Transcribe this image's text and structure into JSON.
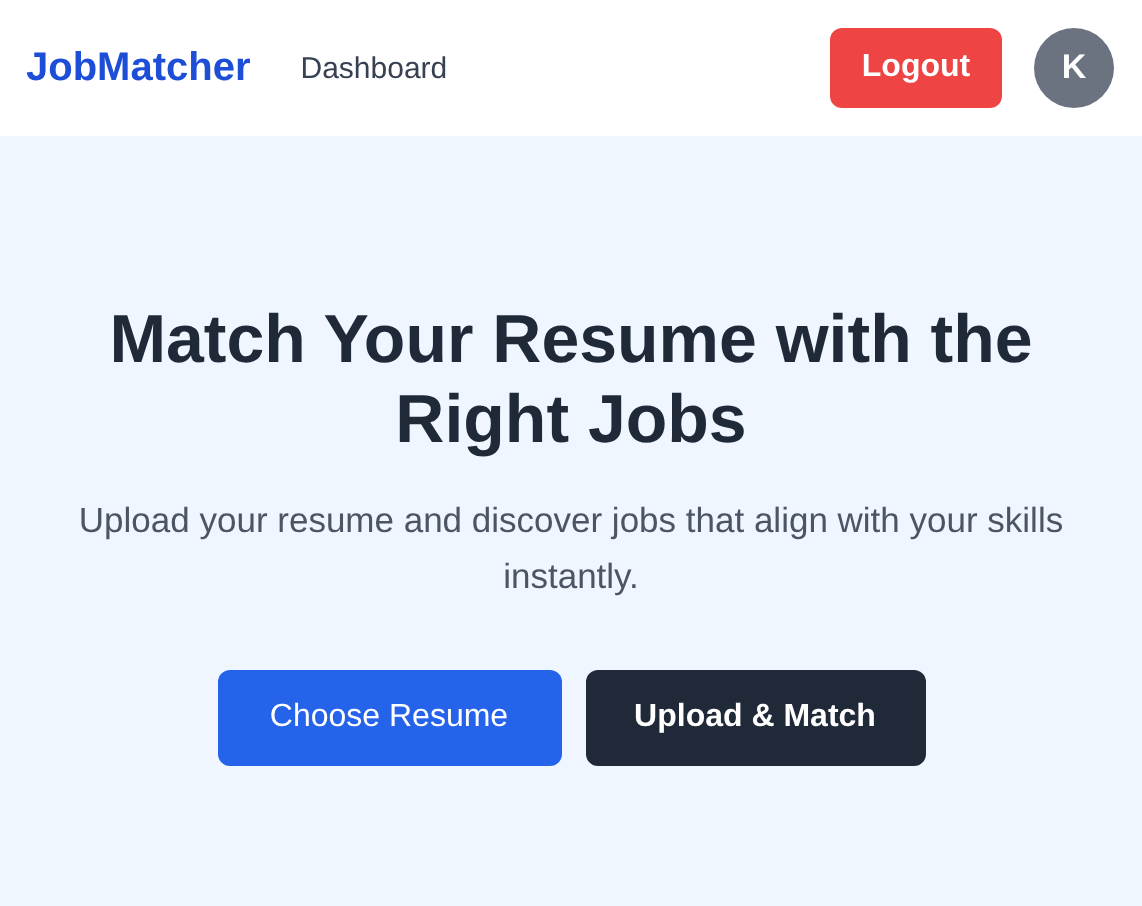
{
  "header": {
    "logo": "JobMatcher",
    "nav": [
      {
        "label": "Dashboard"
      }
    ],
    "logout": "Logout",
    "avatar": "K"
  },
  "hero": {
    "title": "Match Your Resume with the Right Jobs",
    "subtitle": "Upload your resume and discover jobs that align with your skills instantly.",
    "buttons": [
      {
        "label": "Choose Resume",
        "kind": "primary"
      },
      {
        "label": "Upload & Match",
        "kind": "dark"
      }
    ]
  }
}
